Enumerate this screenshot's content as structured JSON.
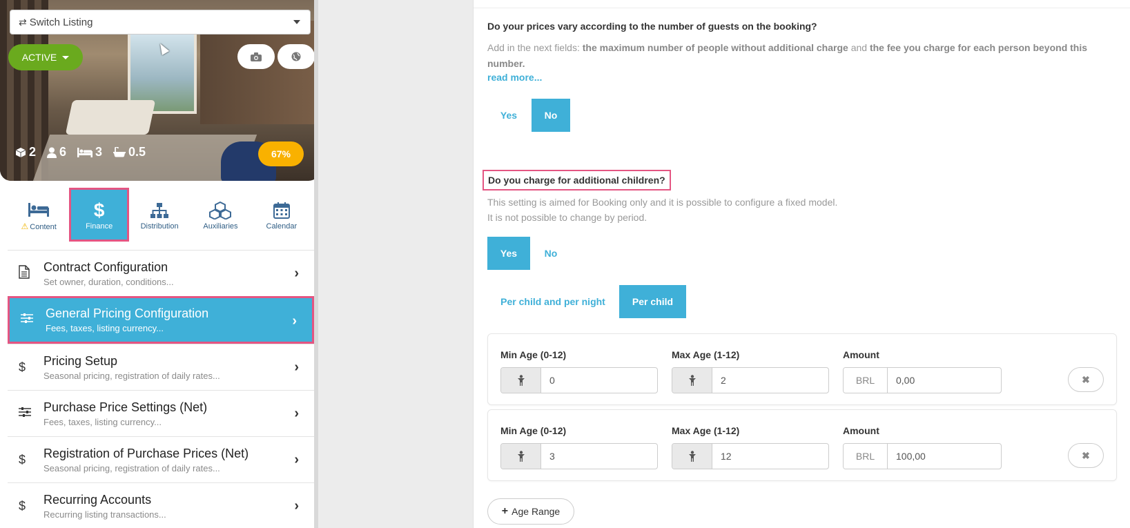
{
  "listing_card": {
    "switch_label": "Switch Listing",
    "status": "ACTIVE",
    "stats": {
      "rooms": "2",
      "guests": "6",
      "beds": "3",
      "baths": "0.5"
    },
    "completion": "67%"
  },
  "tabs": [
    {
      "label": "Content",
      "icon": "bed-icon"
    },
    {
      "label": "Finance",
      "icon": "dollar-icon"
    },
    {
      "label": "Distribution",
      "icon": "sitemap-icon"
    },
    {
      "label": "Auxiliaries",
      "icon": "cubes-icon"
    },
    {
      "label": "Calendar",
      "icon": "calendar-icon"
    }
  ],
  "menu": [
    {
      "title": "Contract Configuration",
      "sub": "Set owner, duration, conditions...",
      "icon": "document-icon"
    },
    {
      "title": "General Pricing Configuration",
      "sub": "Fees, taxes, listing currency...",
      "icon": "sliders-icon"
    },
    {
      "title": "Pricing Setup",
      "sub": "Seasonal pricing, registration of daily rates...",
      "icon": "dollar-icon"
    },
    {
      "title": "Purchase Price Settings (Net)",
      "sub": "Fees, taxes, listing currency...",
      "icon": "sliders-icon"
    },
    {
      "title": "Registration of Purchase Prices (Net)",
      "sub": "Seasonal pricing, registration of daily rates...",
      "icon": "dollar-icon"
    },
    {
      "title": "Recurring Accounts",
      "sub": "Recurring listing transactions...",
      "icon": "dollar-icon"
    }
  ],
  "guests_question": {
    "title": "Do your prices vary according to the number of guests on the booking?",
    "desc_prefix": "Add in the next fields: ",
    "desc_bold1": "the maximum number of people without additional charge",
    "desc_and": " and ",
    "desc_bold2": "the fee you charge for each person beyond this number.",
    "read_more": "read more...",
    "yes": "Yes",
    "no": "No"
  },
  "children_question": {
    "title": "Do you charge for additional children?",
    "line1": "This setting is aimed for Booking only and it is possible to configure a fixed model.",
    "line2": "It is not possible to change by period.",
    "yes": "Yes",
    "no": "No",
    "mode_per_night": "Per child and per night",
    "mode_per_child": "Per child"
  },
  "age_ranges": [
    {
      "min_label": "Min Age (0-12)",
      "min": "0",
      "max_label": "Max Age (1-12)",
      "max": "2",
      "amount_label": "Amount",
      "currency": "BRL",
      "amount": "0,00"
    },
    {
      "min_label": "Min Age (0-12)",
      "min": "3",
      "max_label": "Max Age (1-12)",
      "max": "12",
      "amount_label": "Amount",
      "currency": "BRL",
      "amount": "100,00"
    }
  ],
  "add_age_range": "Age Range",
  "colors": {
    "accent": "#3fb0d8",
    "highlight": "#e45582",
    "active": "#6aaa1e",
    "completion": "#f9b100"
  }
}
